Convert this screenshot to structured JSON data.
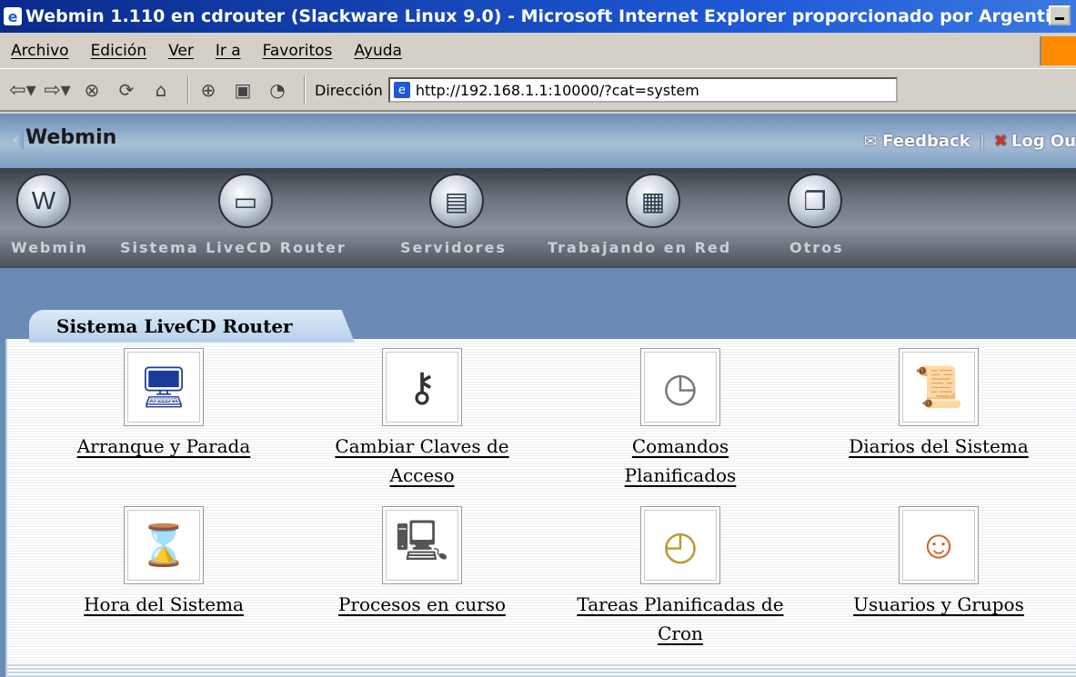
{
  "window": {
    "title": "Webmin 1.110 en cdrouter (Slackware Linux 9.0) - Microsoft Internet Explorer proporcionado por Argenti...",
    "app_icon": "ie-icon"
  },
  "menubar": {
    "items": [
      "Archivo",
      "Edición",
      "Ver",
      "Ir a",
      "Favoritos",
      "Ayuda"
    ]
  },
  "toolbar": {
    "address_label": "Dirección",
    "address_value": "http://192.168.1.1:10000/?cat=system",
    "buttons": [
      "back-icon",
      "forward-icon",
      "stop-icon",
      "refresh-icon",
      "home-icon",
      "search-icon",
      "favorites-icon",
      "history-icon"
    ]
  },
  "webmin": {
    "logo": "Webmin",
    "feedback": "Feedback",
    "logout": "Log Ou"
  },
  "categories": [
    {
      "label": "Webmin",
      "icon": "webmin-icon"
    },
    {
      "label": "Sistema LiveCD Router",
      "icon": "computer-icon"
    },
    {
      "label": "Servidores",
      "icon": "servers-icon"
    },
    {
      "label": "Trabajando en Red",
      "icon": "network-icon"
    },
    {
      "label": "Otros",
      "icon": "others-icon"
    }
  ],
  "tab": {
    "title": "Sistema LiveCD Router"
  },
  "modules": [
    {
      "line1": "Arranque y Parada",
      "line2": "",
      "icon": "monitor-icon"
    },
    {
      "line1": "Cambiar Claves de",
      "line2": "Acceso",
      "icon": "keys-icon"
    },
    {
      "line1": "Comandos",
      "line2": "Planificados",
      "icon": "clock-script-icon"
    },
    {
      "line1": "Diarios del Sistema",
      "line2": "",
      "icon": "scroll-icon"
    },
    {
      "line1": "Hora del Sistema",
      "line2": "",
      "icon": "calendar-hourglass-icon"
    },
    {
      "line1": "Procesos en curso",
      "line2": "",
      "icon": "process-monitor-icon"
    },
    {
      "line1": "Tareas Planificadas de",
      "line2": "Cron",
      "icon": "clocks-icon"
    },
    {
      "line1": "Usuarios y Grupos",
      "line2": "",
      "icon": "user-face-icon"
    }
  ]
}
